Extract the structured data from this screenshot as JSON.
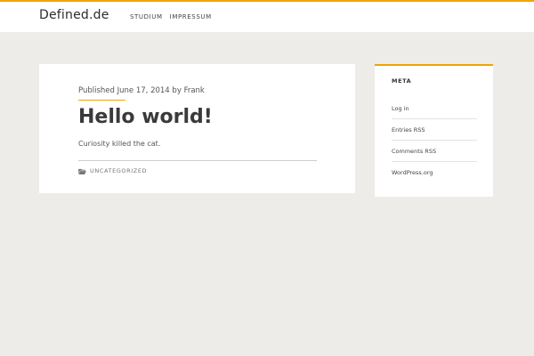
{
  "header": {
    "site_title": "Defined.de",
    "nav": [
      "STUDIUM",
      "IMPRESSUM"
    ]
  },
  "post": {
    "meta_prefix": "Published",
    "date": "June 17, 2014",
    "by": "by",
    "author": "Frank",
    "title": "Hello world!",
    "excerpt": "Curiosity killed the cat.",
    "category_icon": "folder-icon",
    "category": "UNCATEGORIZED"
  },
  "sidebar": {
    "widget_title": "META",
    "links": [
      "Log in",
      "Entries RSS",
      "Comments RSS",
      "WordPress.org"
    ]
  },
  "colors": {
    "accent": "#f0a30a",
    "background": "#edece8"
  }
}
